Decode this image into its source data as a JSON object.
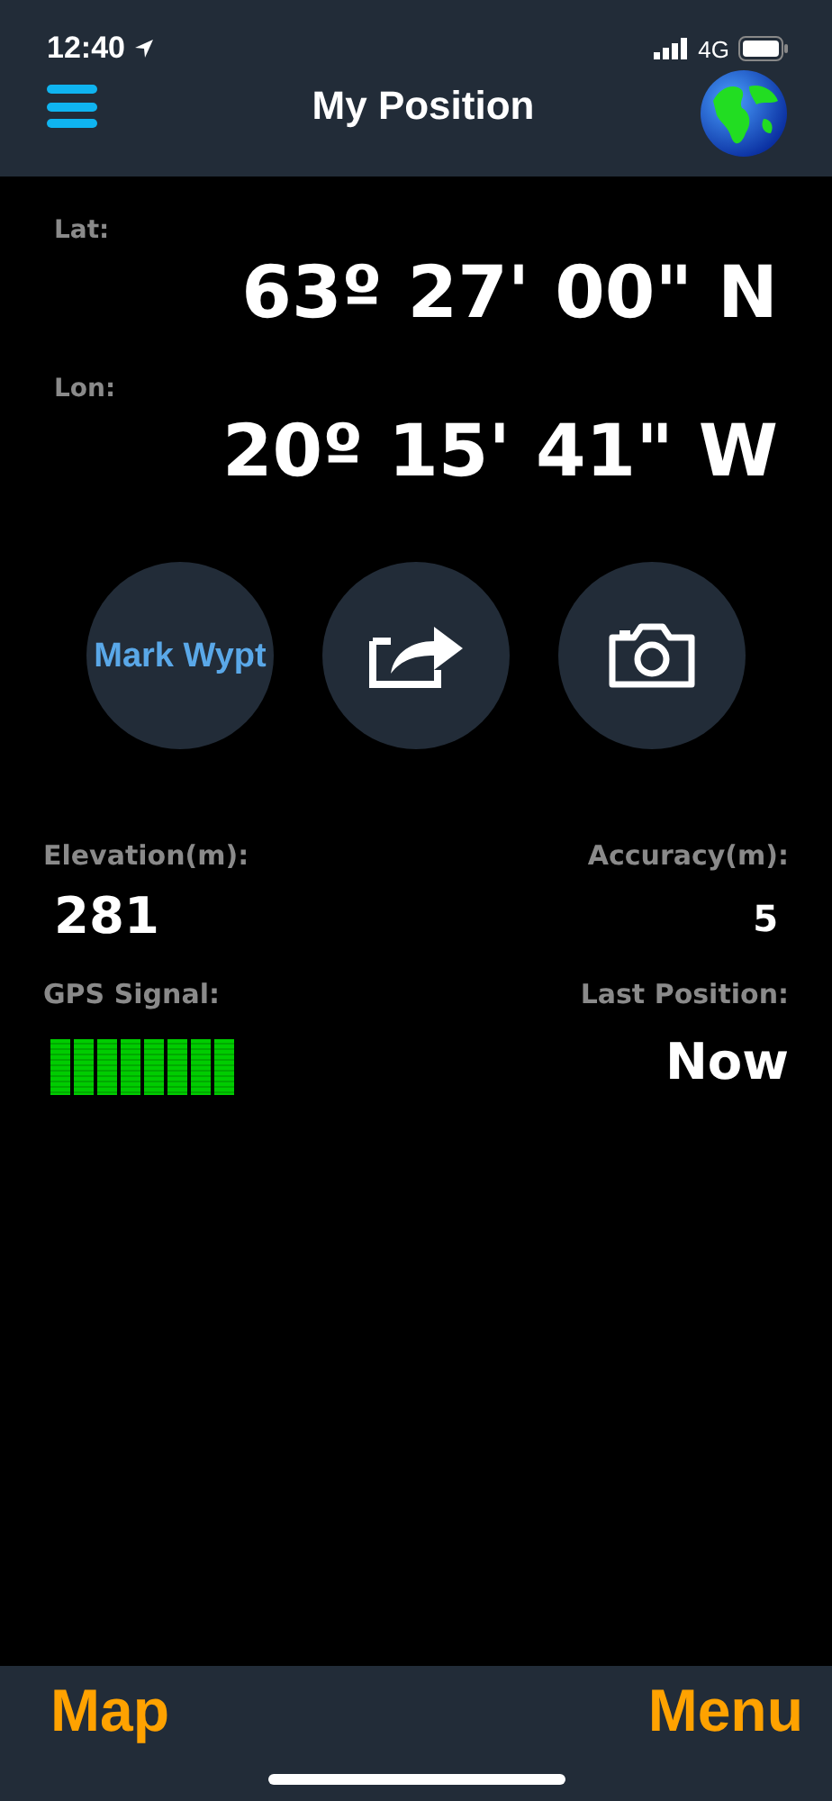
{
  "status_bar": {
    "time": "12:40",
    "network": "4G"
  },
  "nav_bar": {
    "title": "My Position"
  },
  "position": {
    "lat_label": "Lat:",
    "lat": "63º 27' 00\" N",
    "lon_label": "Lon:",
    "lon": "20º 15' 41\" W"
  },
  "actions": [
    {
      "kind": "text",
      "label": "Mark Wypt"
    },
    {
      "kind": "share"
    },
    {
      "kind": "camera"
    }
  ],
  "stats": {
    "elevation_label": "Elevation(m):",
    "elevation": "281",
    "accuracy_label": "Accuracy(m):",
    "accuracy": "5",
    "gps_label": "GPS Signal:",
    "gps_signal": {
      "level": 1
    },
    "last_label": "Last Position:",
    "last": "Now"
  },
  "tab_bar": {
    "left": "Map",
    "right": "Menu"
  }
}
